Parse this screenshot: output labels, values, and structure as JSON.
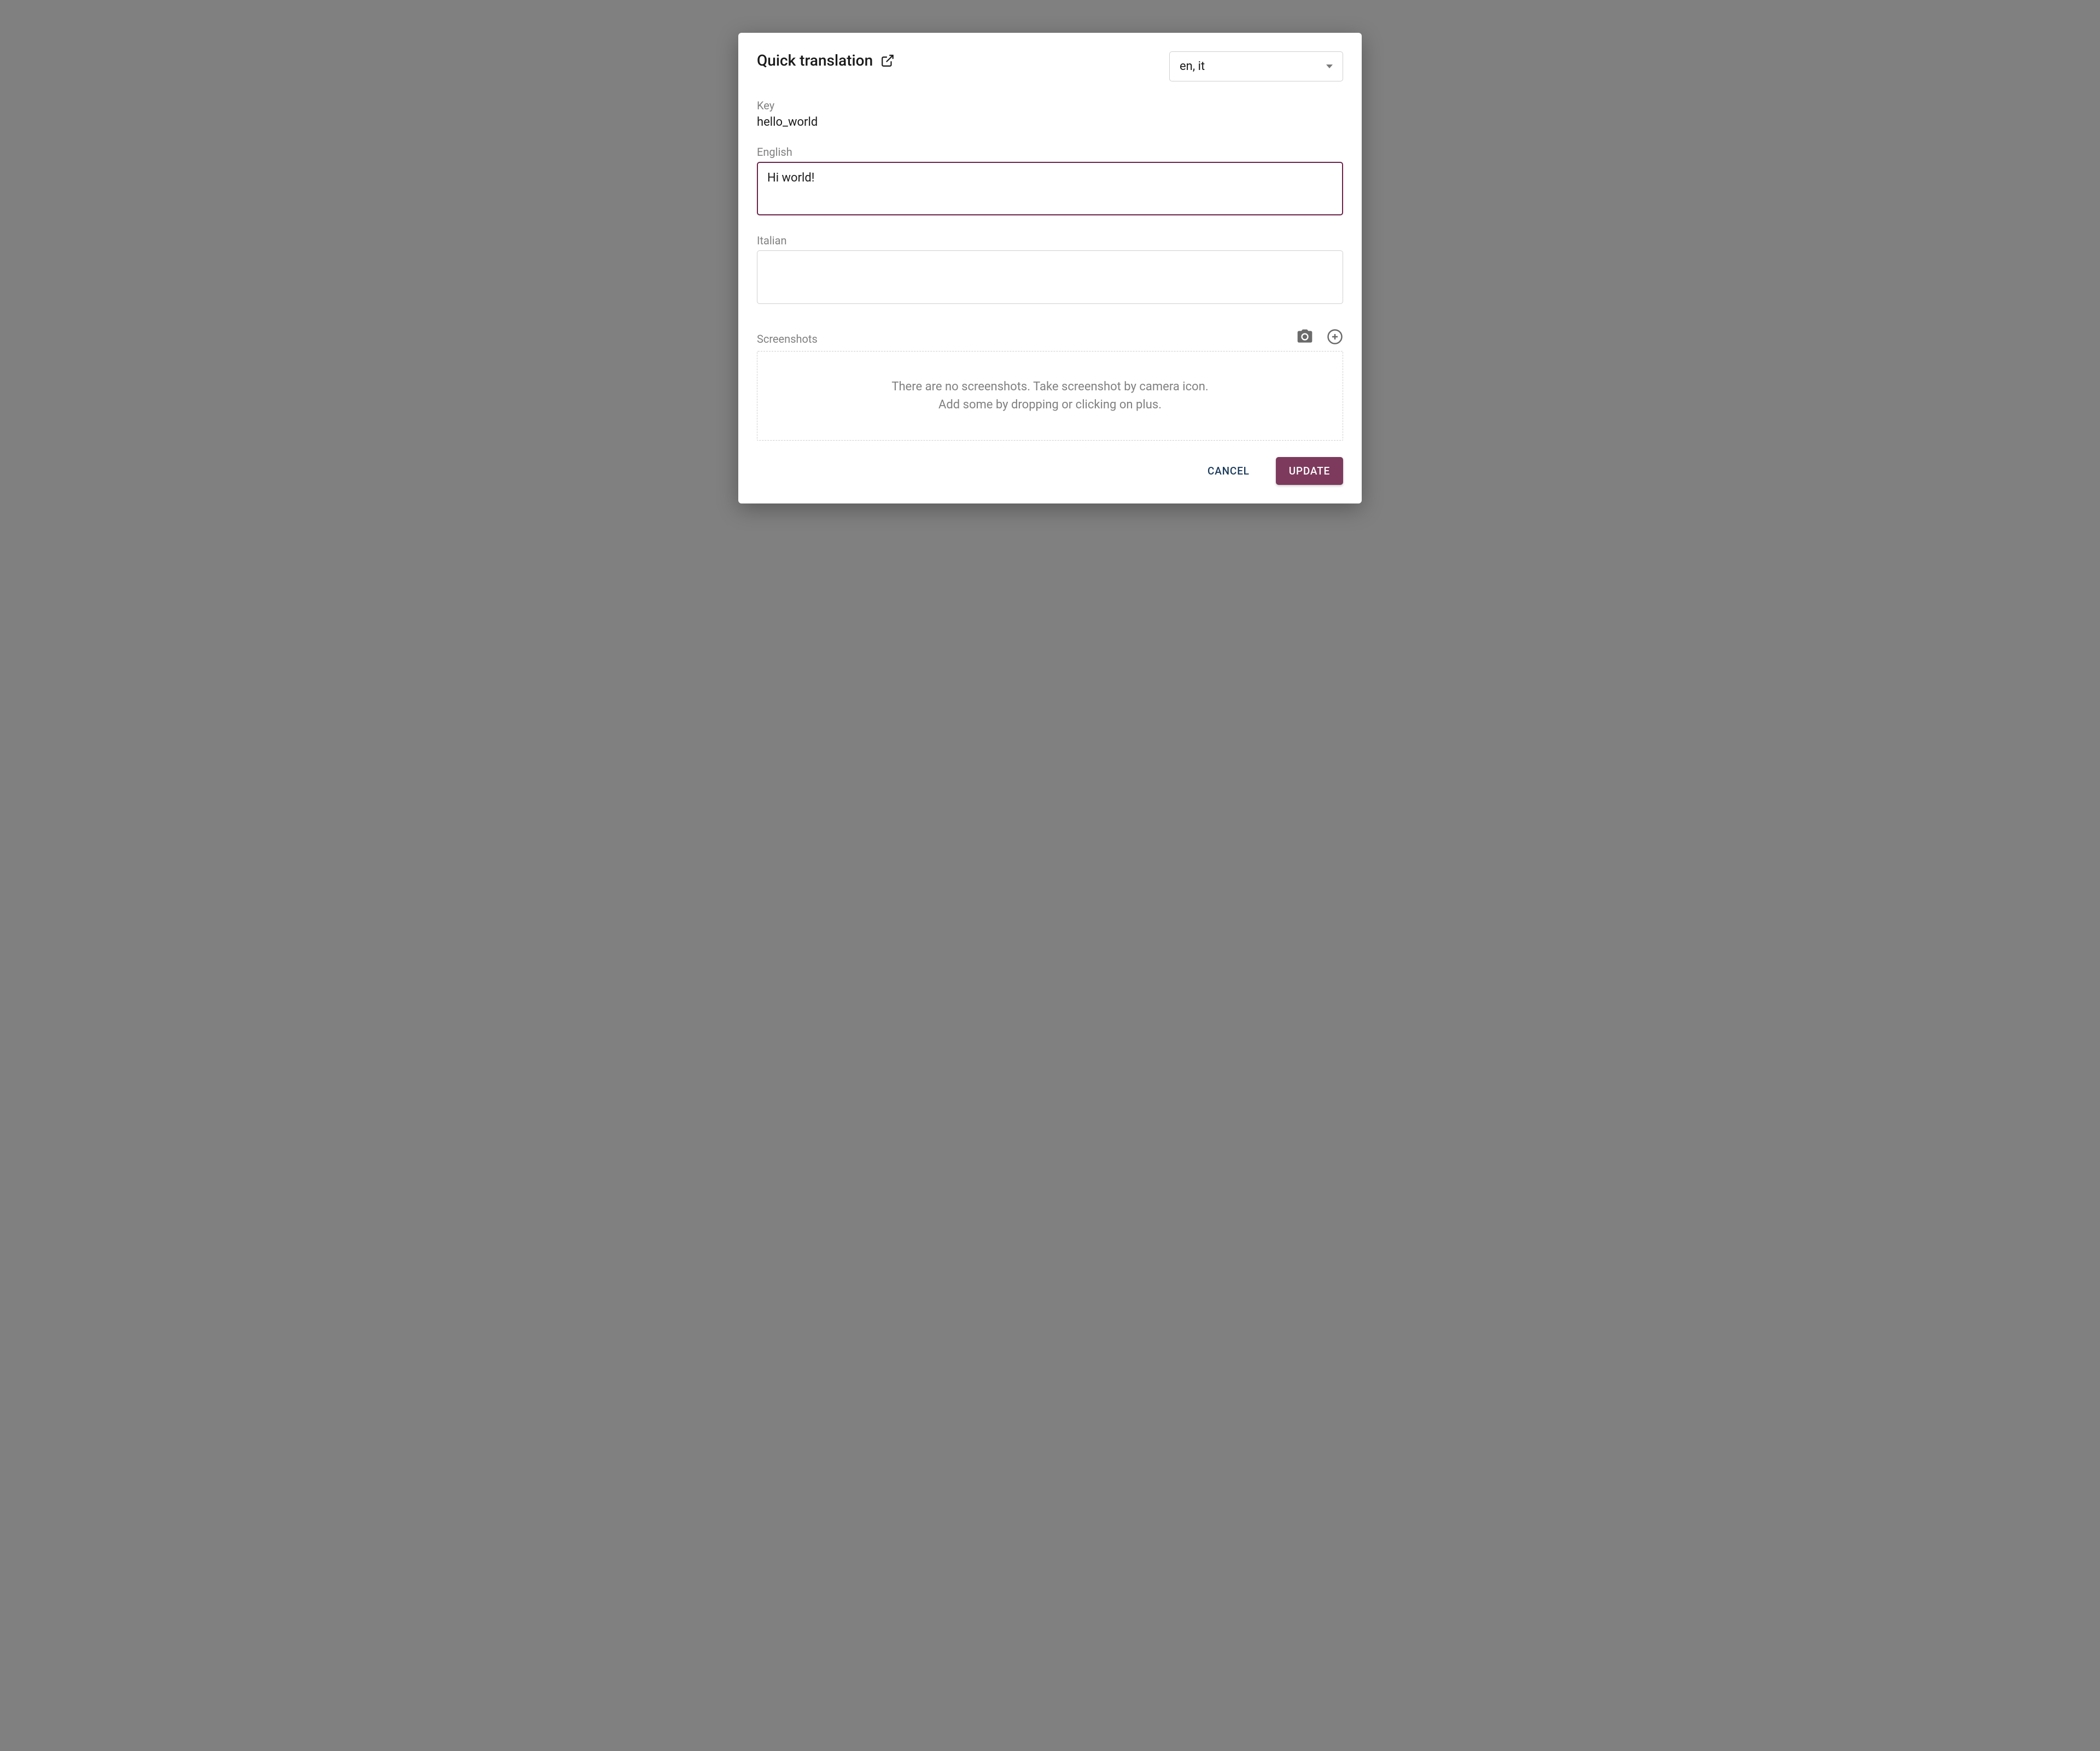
{
  "header": {
    "title": "Quick translation",
    "language_select_value": "en, it"
  },
  "key": {
    "label": "Key",
    "value": "hello_world"
  },
  "translations": [
    {
      "label": "English",
      "value": "Hi world!",
      "focused": true
    },
    {
      "label": "Italian",
      "value": "",
      "focused": false
    }
  ],
  "screenshots": {
    "label": "Screenshots",
    "empty_line1": "There are no screenshots. Take screenshot by camera icon.",
    "empty_line2": "Add some by dropping or clicking on plus."
  },
  "actions": {
    "cancel": "CANCEL",
    "update": "UPDATE"
  }
}
